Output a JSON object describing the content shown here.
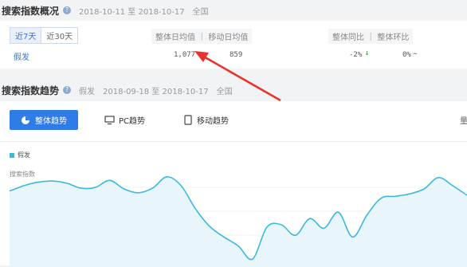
{
  "overview": {
    "title": "搜索指数概况",
    "date_range": "2018-10-11 至 2018-10-17",
    "region": "全国",
    "tabs": [
      {
        "label": "近7天"
      },
      {
        "label": "近30天"
      }
    ],
    "col_avg": "整体日均值 ｜ 移动日均值",
    "col_compare": "整体同比 ｜ 整体环比",
    "keyword": "假发",
    "overall_avg": "1,077",
    "mobile_avg": "859",
    "yoy": "-2%",
    "yoy_arrow": "↓",
    "mom": "0%",
    "mom_dash": "−"
  },
  "trend": {
    "title": "搜索指数趋势",
    "keyword": "假发",
    "date_range": "2018-09-18 至 2018-10-17",
    "region": "全国",
    "btn_all": "整体趋势",
    "btn_pc": "PC趋势",
    "btn_mobile": "移动趋势",
    "right_cut": "量",
    "legend": "假发",
    "ylabel": "搜索指数"
  },
  "chart_data": {
    "type": "area",
    "series": [
      {
        "name": "假发",
        "values": [
          1060,
          1075,
          1085,
          1088,
          1082,
          1068,
          1070,
          1090,
          1066,
          1055,
          1068,
          1100,
          1075,
          1010,
          960,
          930,
          905,
          868,
          958,
          965,
          935,
          982,
          955,
          1000,
          930,
          992,
          1040,
          1045,
          1052,
          1066,
          1098,
          1075,
          1048
        ]
      }
    ],
    "color": "#3ab8e0"
  }
}
